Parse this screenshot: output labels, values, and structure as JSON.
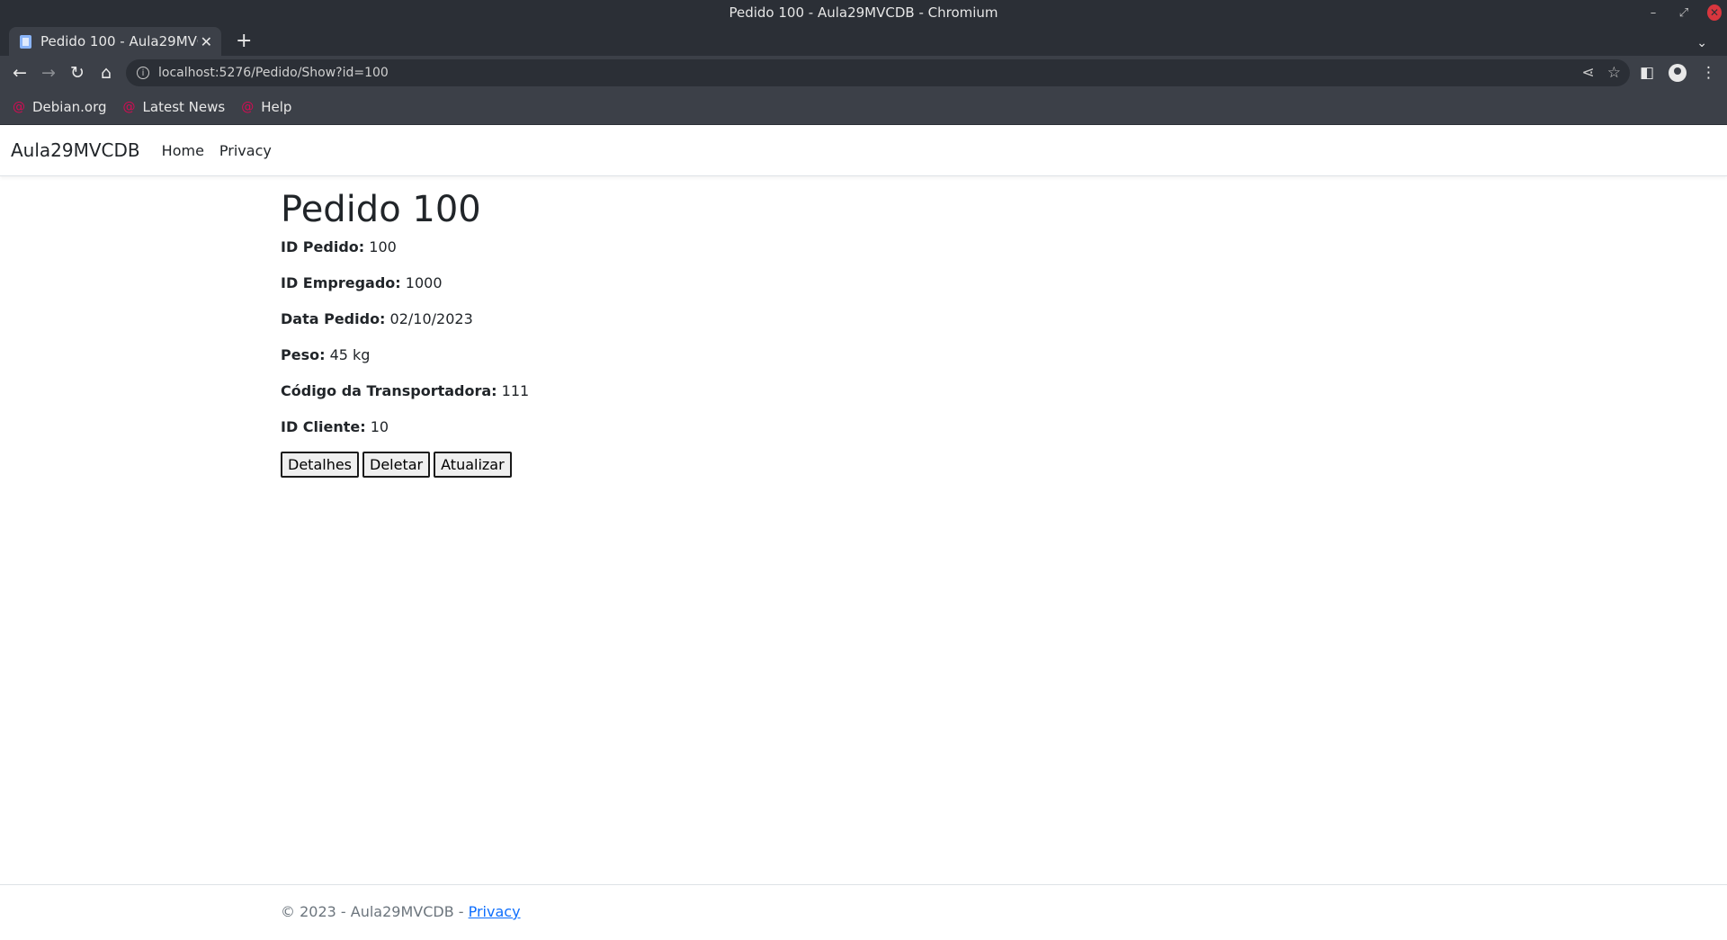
{
  "window": {
    "title": "Pedido 100 - Aula29MVCDB - Chromium"
  },
  "tab": {
    "title": "Pedido 100 - Aula29MVCDB"
  },
  "address_bar": {
    "url": "localhost:5276/Pedido/Show?id=100"
  },
  "bookmarks": [
    {
      "label": "Debian.org",
      "icon": "debian-icon"
    },
    {
      "label": "Latest News",
      "icon": "debian-icon"
    },
    {
      "label": "Help",
      "icon": "debian-icon"
    }
  ],
  "navbar": {
    "brand": "Aula29MVCDB",
    "links": [
      "Home",
      "Privacy"
    ]
  },
  "pedido": {
    "title": "Pedido 100",
    "fields": [
      {
        "label": "ID Pedido:",
        "value": "100"
      },
      {
        "label": "ID Empregado:",
        "value": "1000"
      },
      {
        "label": "Data Pedido:",
        "value": "02/10/2023"
      },
      {
        "label": "Peso:",
        "value": "45 kg"
      },
      {
        "label": "Código da Transportadora:",
        "value": "111"
      },
      {
        "label": "ID Cliente:",
        "value": "10"
      }
    ],
    "buttons": {
      "details": "Detalhes",
      "delete": "Deletar",
      "update": "Atualizar"
    }
  },
  "footer": {
    "text": "© 2023 - Aula29MVCDB - ",
    "link": "Privacy"
  },
  "colors": {
    "chrome_dark": "#2b2f36",
    "chrome_toolbar": "#3c4048",
    "link": "#0d6efd",
    "footer_text": "#6c757d"
  }
}
